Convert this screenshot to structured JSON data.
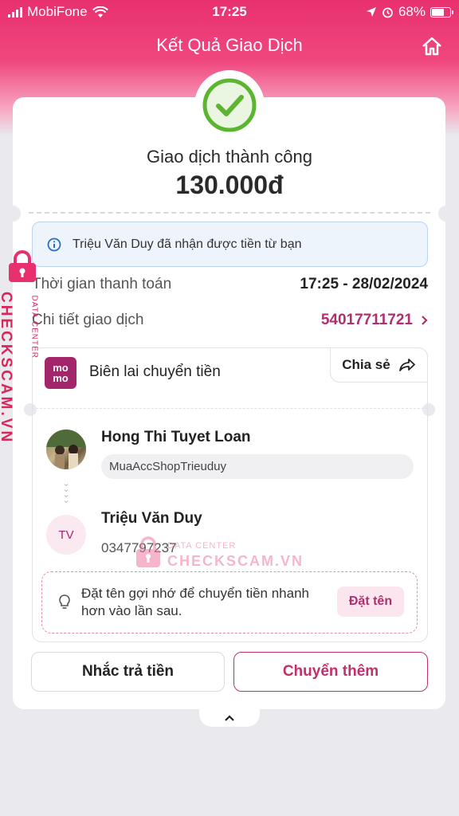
{
  "status_bar": {
    "carrier": "MobiFone",
    "time": "17:25",
    "battery": "68%",
    "battery_level": 0.68
  },
  "header": {
    "title": "Kết Quả Giao Dịch"
  },
  "result": {
    "status_text": "Giao dịch thành công",
    "amount": "130.000đ"
  },
  "info_notice": "Triệu Văn Duy đã nhận được tiền từ bạn",
  "details": {
    "payment_time_label": "Thời gian thanh toán",
    "payment_time_value": "17:25 - 28/02/2024",
    "transaction_label": "Chi tiết giao dịch",
    "transaction_id": "54017711721"
  },
  "receipt": {
    "logo_top": "mo",
    "logo_bottom": "mo",
    "title": "Biên lai chuyển tiền",
    "share_label": "Chia sẻ",
    "sender_name": "Hong Thi Tuyet Loan",
    "memo": "MuaAccShopTrieuduy",
    "receiver_initials": "TV",
    "receiver_name": "Triệu Văn Duy",
    "receiver_phone": "0347797237",
    "tip_text": "Đặt tên gợi nhớ để chuyển tiền nhanh hơn vào lần sau.",
    "tip_button": "Đặt tên"
  },
  "actions": {
    "remind_label": "Nhắc trả tiền",
    "transfer_more_label": "Chuyển thêm"
  },
  "watermark": {
    "vertical_brand": "CHECKSCAM.VN",
    "vertical_sub": "DATA CENTER",
    "center_sub": "DATA CENTER",
    "center_brand": "CHECKSCAM.VN"
  },
  "colors": {
    "brand_pink": "#e8306f",
    "momo": "#a4266a",
    "success_green": "#5cb531"
  }
}
